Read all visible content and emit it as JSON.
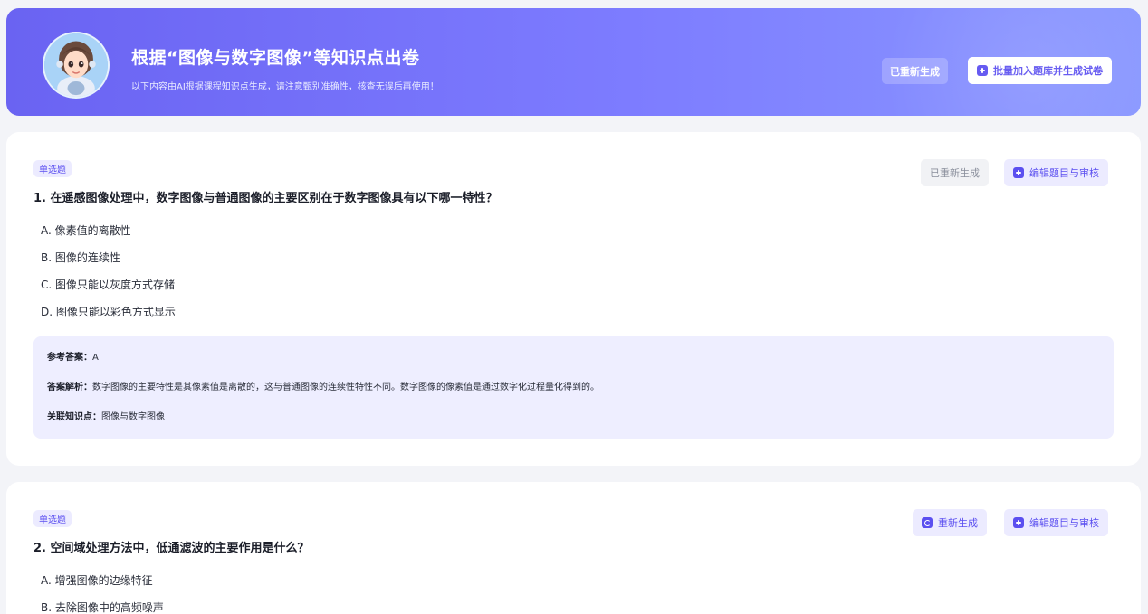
{
  "banner": {
    "title": "根据“图像与数字图像”等知识点出卷",
    "subtitle": "以下内容由AI根据课程知识点生成，请注意甄别准确性，核查无误后再使用！",
    "regen_label": "已重新生成",
    "batch_label": "批量加入题库并生成试卷"
  },
  "questions": [
    {
      "type": "单选题",
      "title": "1. 在遥感图像处理中，数字图像与普通图像的主要区别在于数字图像具有以下哪一特性？",
      "options": [
        "A. 像素值的离散性",
        "B. 图像的连续性",
        "C. 图像只能以灰度方式存储",
        "D. 图像只能以彩色方式显示"
      ],
      "regen_label": "已重新生成",
      "edit_label": "编辑题目与审核",
      "answer_key": "参考答案：",
      "answer_value": "A",
      "analysis_key": "答案解析：",
      "analysis_value": "数字图像的主要特性是其像素值是离散的，这与普通图像的连续性特性不同。数字图像的像素值是通过数字化过程量化得到的。",
      "knowledge_key": "关联知识点：",
      "knowledge_value": "图像与数字图像"
    },
    {
      "type": "单选题",
      "title": "2. 空间域处理方法中，低通滤波的主要作用是什么？",
      "options": [
        "A. 增强图像的边缘特征",
        "B. 去除图像中的高频噪声"
      ],
      "regen_label": "重新生成",
      "edit_label": "编辑题目与审核"
    }
  ]
}
